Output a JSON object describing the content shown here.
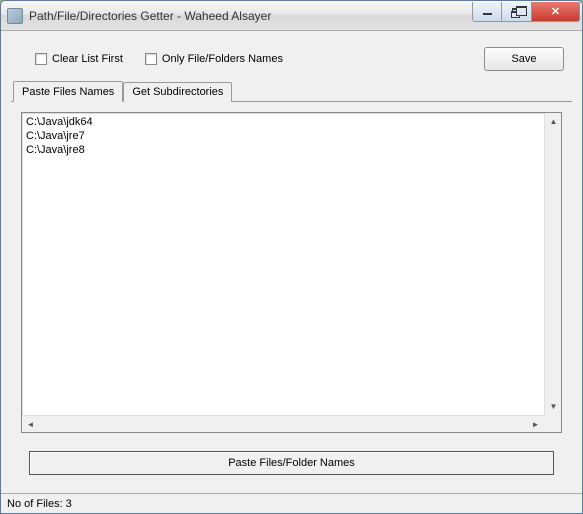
{
  "window": {
    "title": "Path/File/Directories Getter - Waheed Alsayer"
  },
  "toolbar": {
    "clear_list_first_label": "Clear List First",
    "only_names_label": "Only File/Folders Names",
    "save_label": "Save"
  },
  "tabs": {
    "paste_files_label": "Paste Files Names",
    "get_subdirs_label": "Get Subdirectories"
  },
  "list": {
    "items": [
      "C:\\Java\\jdk64",
      "C:\\Java\\jre7",
      "C:\\Java\\jre8"
    ]
  },
  "actions": {
    "paste_button_label": "Paste Files/Folder Names"
  },
  "status": {
    "text": "No of Files: 3"
  }
}
